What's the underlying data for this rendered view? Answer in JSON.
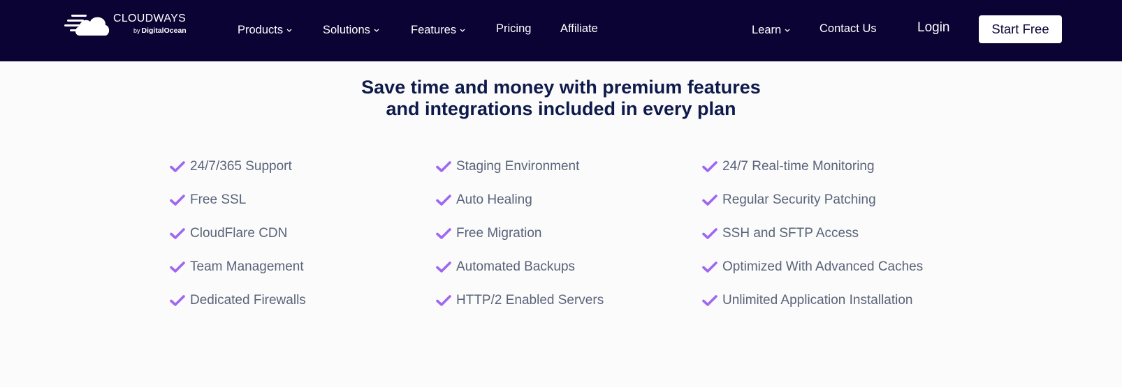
{
  "brand": {
    "name": "CLOUDWAYS",
    "by": "by",
    "parent": "DigitalOcean"
  },
  "nav": {
    "left": [
      {
        "label": "Products",
        "dropdown": true
      },
      {
        "label": "Solutions",
        "dropdown": true
      },
      {
        "label": "Features",
        "dropdown": true
      },
      {
        "label": "Pricing",
        "dropdown": false
      },
      {
        "label": "Affiliate",
        "dropdown": false
      }
    ],
    "right": [
      {
        "label": "Learn",
        "dropdown": true
      },
      {
        "label": "Contact Us",
        "dropdown": false
      }
    ],
    "login": "Login",
    "start_free": "Start Free",
    "chevron": "chevron-down-icon"
  },
  "headline": {
    "line1": "Save time and money with premium features",
    "line2": "and integrations included in every plan"
  },
  "features": {
    "icon": "check-icon",
    "accent_color": "#9f67f0",
    "columns": [
      [
        "24/7/365 Support",
        "Free SSL",
        "CloudFlare CDN",
        "Team Management",
        "Dedicated Firewalls"
      ],
      [
        "Staging Environment",
        "Auto Healing",
        "Free Migration",
        "Automated Backups",
        "HTTP/2 Enabled Servers"
      ],
      [
        "24/7 Real-time Monitoring",
        "Regular Security Patching",
        "SSH and SFTP Access",
        "Optimized With Advanced Caches",
        "Unlimited Application Installation"
      ]
    ]
  },
  "colors": {
    "nav_bg": "#0a0333",
    "page_bg": "#fbfbfc",
    "headline": "#0d1a4a",
    "feature_text": "#5a6378"
  }
}
